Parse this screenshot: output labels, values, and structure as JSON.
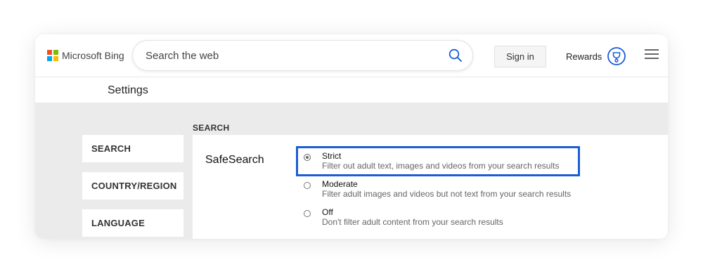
{
  "header": {
    "brand": "Microsoft Bing",
    "logo_colors": [
      "#f25022",
      "#7fba00",
      "#00a4ef",
      "#ffb900"
    ],
    "search_placeholder": "Search the web",
    "search_icon": "search-icon",
    "signin_label": "Sign in",
    "rewards_label": "Rewards",
    "rewards_icon": "rewards-trophy-icon",
    "menu_icon": "hamburger-menu-icon"
  },
  "settings": {
    "title": "Settings"
  },
  "sidebar": {
    "items": [
      {
        "label": "SEARCH"
      },
      {
        "label": "COUNTRY/REGION"
      },
      {
        "label": "LANGUAGE"
      }
    ]
  },
  "main": {
    "section_title": "SEARCH",
    "safesearch": {
      "label": "SafeSearch",
      "highlight_color": "#1a5dd6",
      "options": [
        {
          "title": "Strict",
          "description": "Filter out adult text, images and videos from your search results",
          "selected": true
        },
        {
          "title": "Moderate",
          "description": "Filter adult images and videos but not text from your search results",
          "selected": false
        },
        {
          "title": "Off",
          "description": "Don't filter adult content from your search results",
          "selected": false
        }
      ]
    }
  },
  "colors": {
    "accent": "#1a5dd6",
    "panel_gray": "#ebebeb"
  }
}
